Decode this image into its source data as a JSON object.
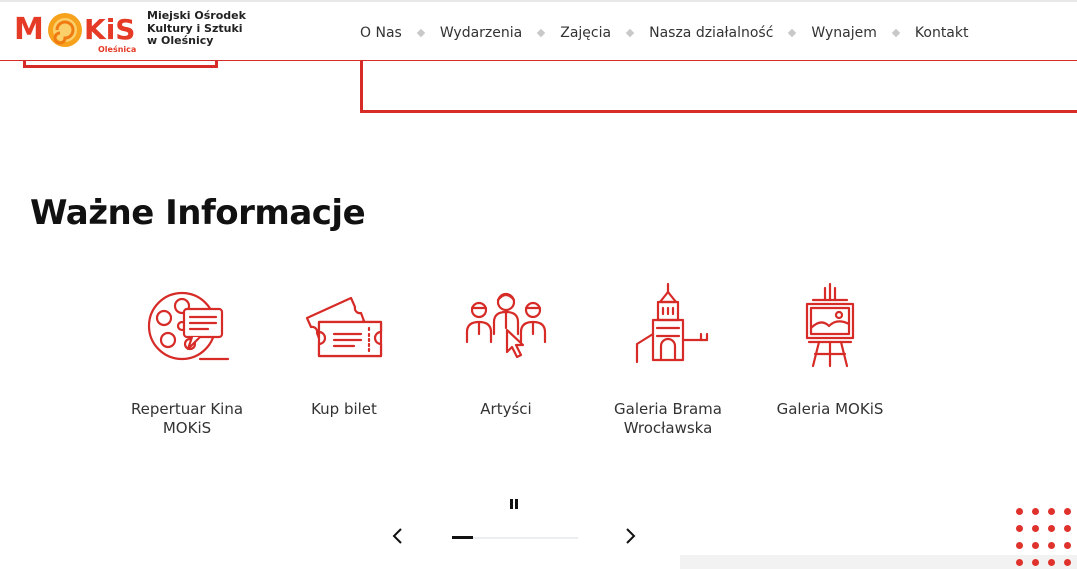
{
  "header": {
    "logo_brand": "MOKiS",
    "logo_town": "Oleśnica",
    "org_name_lines": [
      "Miejski Ośrodek",
      "Kultury i Sztuki",
      "w Oleśnicy"
    ],
    "nav": [
      {
        "label": "O Nas"
      },
      {
        "label": "Wydarzenia"
      },
      {
        "label": "Zajęcia"
      },
      {
        "label": "Nasza działalność"
      },
      {
        "label": "Wynajem"
      },
      {
        "label": "Kontakt"
      }
    ]
  },
  "section": {
    "title": "Ważne Informacje",
    "cards": [
      {
        "label": "Repertuar Kina MOKiS",
        "icon": "film-reel-chat-icon"
      },
      {
        "label": "Kup bilet",
        "icon": "tickets-icon"
      },
      {
        "label": "Artyści",
        "icon": "artists-icon"
      },
      {
        "label": "Galeria Brama Wrocławska",
        "icon": "gate-tower-icon"
      },
      {
        "label": "Galeria MOKiS",
        "icon": "easel-painting-icon"
      }
    ]
  },
  "carousel": {
    "progress": 0.17
  },
  "colors": {
    "accent": "#d62b27",
    "text": "#222222",
    "dots": "#e0322c"
  }
}
